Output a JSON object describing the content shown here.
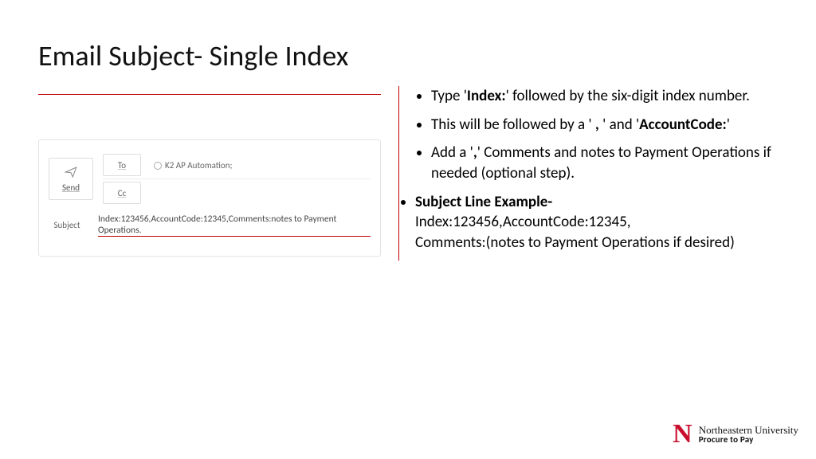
{
  "title": "Email Subject- Single Index",
  "email": {
    "send_label": "Send",
    "to_label": "To",
    "cc_label": "Cc",
    "subject_label": "Subject",
    "to_value": "K2 AP Automation;",
    "cc_value": "",
    "subject_value": "Index:123456,AccountCode:12345,Comments:notes to Payment Operations."
  },
  "bullets": {
    "b1_pre": "Type '",
    "b1_bold": "Index:",
    "b1_post": "' followed by the six-digit index number.",
    "b2_pre": "This will be followed by a ' ",
    "b2_comma": ",",
    "b2_mid": " ' and '",
    "b2_bold": "AccountCode:",
    "b2_post": "'",
    "b3_pre": "Add a '",
    "b3_comma": ",",
    "b3_post": "' Comments and notes to Payment Operations if needed (optional step).",
    "b4_bold": "Subject Line Example-",
    "b4_line1": "Index:123456,AccountCode:12345,",
    "b4_line2": "Comments:(notes to Payment Operations if desired)"
  },
  "logo": {
    "n": "N",
    "line1": "Northeastern University",
    "line2": "Procure to Pay"
  }
}
